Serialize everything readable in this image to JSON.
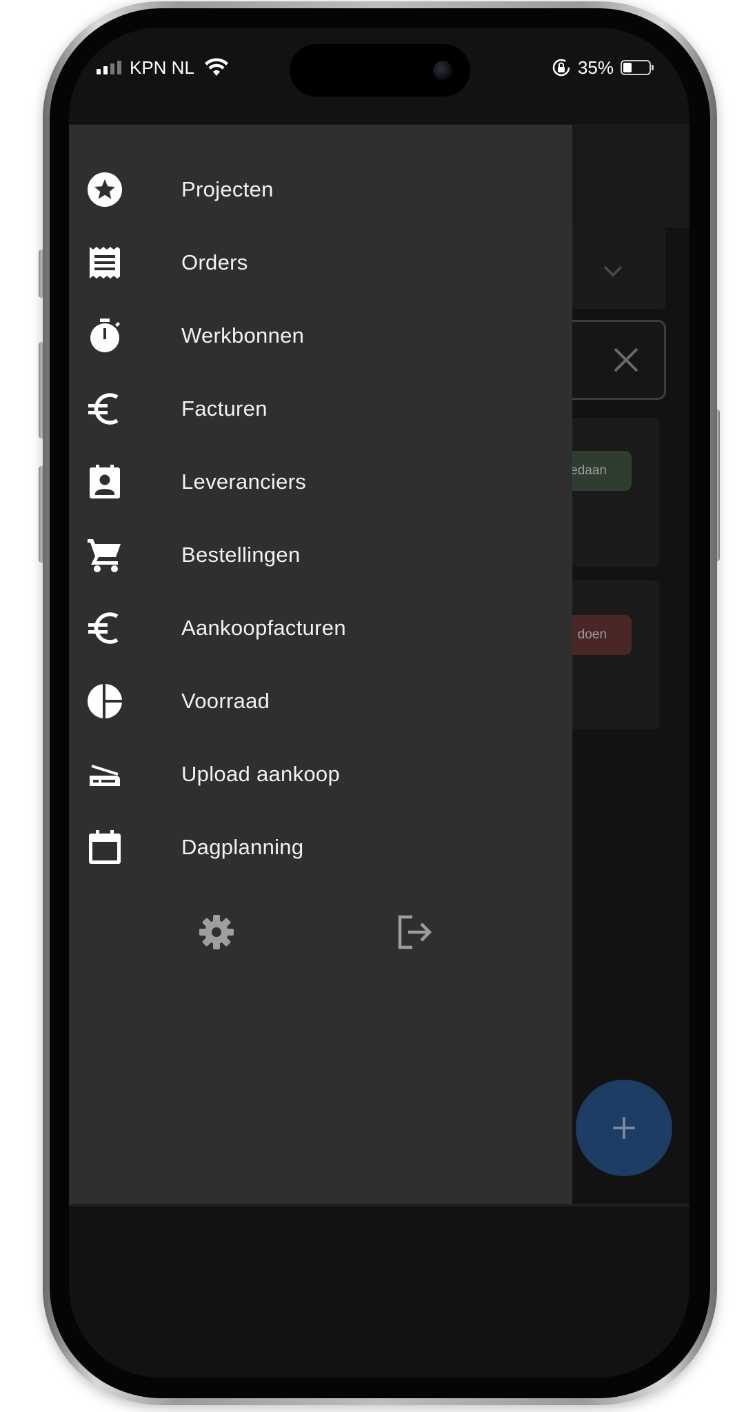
{
  "status_bar": {
    "carrier": "KPN NL",
    "battery_percent": "35%",
    "signal_bars": 4,
    "signal_bars_active": 2,
    "icons": [
      "signal-icon",
      "wifi-icon",
      "rotation-lock-icon",
      "battery-icon"
    ]
  },
  "drawer": {
    "items": [
      {
        "label": "Projecten",
        "icon": "star-circle-icon"
      },
      {
        "label": "Orders",
        "icon": "receipt-icon"
      },
      {
        "label": "Werkbonnen",
        "icon": "stopwatch-icon"
      },
      {
        "label": "Facturen",
        "icon": "euro-icon"
      },
      {
        "label": "Leveranciers",
        "icon": "contact-card-icon"
      },
      {
        "label": "Bestellingen",
        "icon": "shopping-cart-icon"
      },
      {
        "label": "Aankoopfacturen",
        "icon": "euro-icon"
      },
      {
        "label": "Voorraad",
        "icon": "pie-chart-icon"
      },
      {
        "label": "Upload aankoop",
        "icon": "scanner-icon"
      },
      {
        "label": "Dagplanning",
        "icon": "calendar-icon"
      }
    ],
    "footer": {
      "settings_icon": "gear-icon",
      "logout_icon": "logout-icon"
    }
  },
  "background": {
    "badge_done": "edaan",
    "badge_todo": "doen",
    "fab_icon": "plus-icon",
    "colors": {
      "badge_done_bg": "#2f3d30",
      "badge_todo_bg": "#4a2626",
      "fab_bg": "#1d3d64"
    }
  },
  "colors": {
    "drawer_bg": "#2f2f2f",
    "screen_bg": "#121212",
    "text": "#f2f2f2",
    "muted_icon": "#9e9e9e"
  }
}
